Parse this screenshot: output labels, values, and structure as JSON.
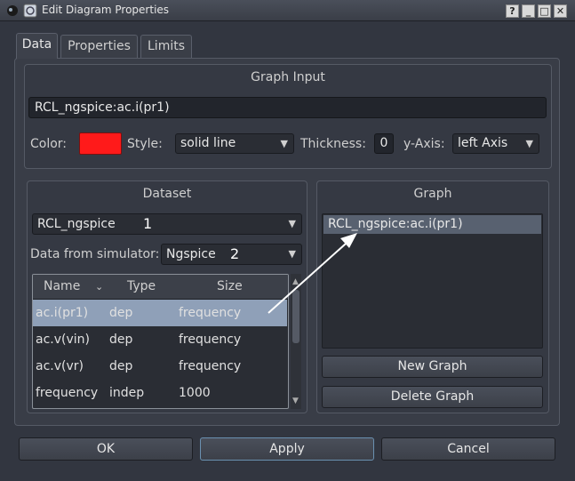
{
  "window": {
    "title": "Edit Diagram Properties",
    "buttons": [
      "?",
      "_",
      "□",
      "✕"
    ]
  },
  "tabs": [
    {
      "label": "Data",
      "active": true
    },
    {
      "label": "Properties",
      "active": false
    },
    {
      "label": "Limits",
      "active": false
    }
  ],
  "graph_input": {
    "title": "Graph Input",
    "value": "RCL_ngspice:ac.i(pr1)",
    "color_label": "Color:",
    "color_value": "#ff1a1a",
    "style_label": "Style:",
    "style_value": "solid line",
    "thickness_label": "Thickness:",
    "thickness_value": "0",
    "yaxis_label": "y-Axis:",
    "yaxis_value": "left Axis"
  },
  "dataset": {
    "title": "Dataset",
    "selected": "RCL_ngspice",
    "marker1": "1",
    "simulator_label": "Data from simulator:",
    "simulator_value": "Ngspice",
    "marker2": "2",
    "columns": [
      "Name",
      "Type",
      "Size"
    ],
    "rows": [
      {
        "name": "ac.i(pr1)",
        "type": "dep",
        "size": "frequency",
        "selected": true
      },
      {
        "name": "ac.v(vin)",
        "type": "dep",
        "size": "frequency",
        "selected": false
      },
      {
        "name": "ac.v(vr)",
        "type": "dep",
        "size": "frequency",
        "selected": false
      },
      {
        "name": "frequency",
        "type": "indep",
        "size": "1000",
        "selected": false
      }
    ]
  },
  "graph": {
    "title": "Graph",
    "items": [
      "RCL_ngspice:ac.i(pr1)"
    ],
    "new_button": "New Graph",
    "delete_button": "Delete Graph"
  },
  "footer": {
    "ok": "OK",
    "apply": "Apply",
    "cancel": "Cancel"
  },
  "colors": {
    "accent_selection": "#8fa0b8",
    "background": "#323640"
  }
}
